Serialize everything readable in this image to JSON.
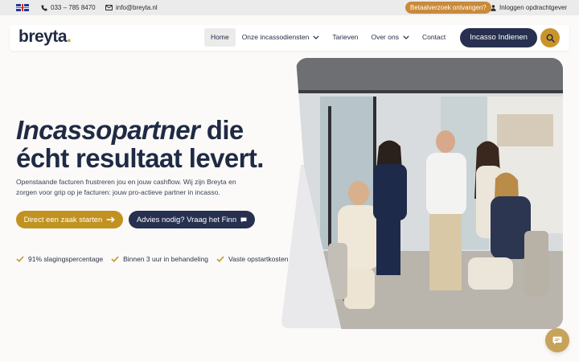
{
  "topbar": {
    "language_icon": "uk-flag-icon",
    "phone": "033 – 785 8470",
    "email": "info@breyta.nl",
    "pay_request": "Betaalverzoek ontvangen?",
    "login": "Inloggen opdrachtgever"
  },
  "header": {
    "logo_text": "breyta",
    "logo_dot": ".",
    "nav": [
      {
        "label": "Home",
        "active": true
      },
      {
        "label": "Onze incassodiensten",
        "dropdown": true
      },
      {
        "label": "Tarieven"
      },
      {
        "label": "Over ons",
        "dropdown": true
      },
      {
        "label": "Contact"
      }
    ],
    "cta": "Incasso Indienen",
    "search_icon": "search-icon"
  },
  "hero": {
    "title_italic": "Incassopartner",
    "title_rest1": " die",
    "title_line2": "écht resultaat levert.",
    "subtitle": "Openstaande facturen frustreren jou en jouw cashflow. Wij zijn Breyta en zorgen voor grip op je facturen: jouw pro-actieve partner in incasso.",
    "btn_primary": "Direct een zaak starten",
    "btn_secondary": "Advies nodig? Vraag het Finn",
    "checks": [
      "91% slagingspercentage",
      "Binnen 3 uur in behandeling",
      "Vaste opstartkosten"
    ]
  },
  "colors": {
    "navy": "#27304f",
    "gold": "#c1921f",
    "orange": "#c98a3a"
  },
  "chat_icon": "chat-icon"
}
